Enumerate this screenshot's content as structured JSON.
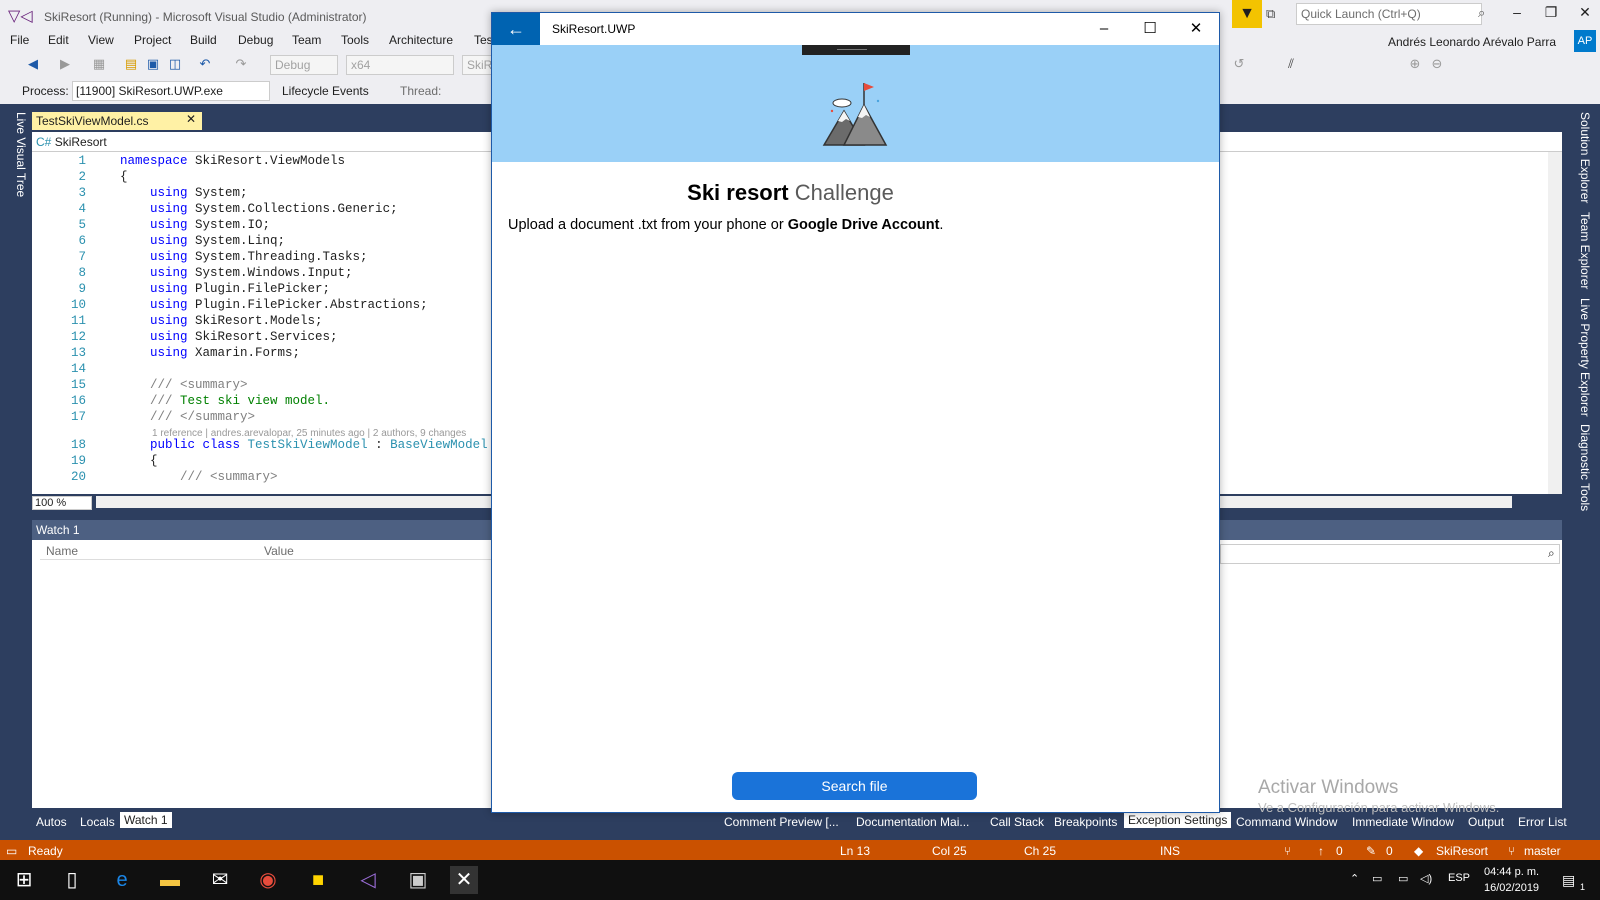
{
  "vs": {
    "title": "SkiResort (Running) - Microsoft Visual Studio  (Administrator)",
    "quick_launch_placeholder": "Quick Launch (Ctrl+Q)",
    "menu": [
      "File",
      "Edit",
      "View",
      "Project",
      "Build",
      "Debug",
      "Team",
      "Tools",
      "Architecture",
      "Tes"
    ],
    "user": "Andrés Leonardo Arévalo Parra",
    "user_initials": "AP",
    "config": "Debug",
    "platform": "x64",
    "startup_project": "SkiRe",
    "process_label": "Process:",
    "process_value": "[11900] SkiResort.UWP.exe",
    "lifecycle_events": "Lifecycle Events",
    "thread_label": "Thread:",
    "live_visual_tree": "Live Visual Tree",
    "doc_tab": "TestSkiViewModel.cs",
    "nav_project": "SkiResort",
    "zoom": "100 %",
    "right_tabs": [
      "Solution Explorer",
      "Team Explorer",
      "Live Property Explorer",
      "Diagnostic Tools"
    ],
    "code": {
      "lines": [
        {
          "n": "1",
          "parts": [
            {
              "c": "kw",
              "t": "namespace"
            },
            {
              "c": "",
              "t": " SkiResort.ViewModels"
            }
          ]
        },
        {
          "n": "2",
          "parts": [
            {
              "c": "",
              "t": "{"
            }
          ]
        },
        {
          "n": "3",
          "parts": [
            {
              "c": "",
              "t": "    "
            },
            {
              "c": "kw",
              "t": "using"
            },
            {
              "c": "",
              "t": " System;"
            }
          ]
        },
        {
          "n": "4",
          "parts": [
            {
              "c": "",
              "t": "    "
            },
            {
              "c": "kw",
              "t": "using"
            },
            {
              "c": "",
              "t": " System.Collections.Generic;"
            }
          ]
        },
        {
          "n": "5",
          "parts": [
            {
              "c": "",
              "t": "    "
            },
            {
              "c": "kw",
              "t": "using"
            },
            {
              "c": "",
              "t": " System.IO;"
            }
          ]
        },
        {
          "n": "6",
          "parts": [
            {
              "c": "",
              "t": "    "
            },
            {
              "c": "kw",
              "t": "using"
            },
            {
              "c": "",
              "t": " System.Linq;"
            }
          ]
        },
        {
          "n": "7",
          "parts": [
            {
              "c": "",
              "t": "    "
            },
            {
              "c": "kw",
              "t": "using"
            },
            {
              "c": "",
              "t": " System.Threading.Tasks;"
            }
          ]
        },
        {
          "n": "8",
          "parts": [
            {
              "c": "",
              "t": "    "
            },
            {
              "c": "kw",
              "t": "using"
            },
            {
              "c": "",
              "t": " System.Windows.Input;"
            }
          ]
        },
        {
          "n": "9",
          "parts": [
            {
              "c": "",
              "t": "    "
            },
            {
              "c": "kw",
              "t": "using"
            },
            {
              "c": "",
              "t": " Plugin.FilePicker;"
            }
          ]
        },
        {
          "n": "10",
          "parts": [
            {
              "c": "",
              "t": "    "
            },
            {
              "c": "kw",
              "t": "using"
            },
            {
              "c": "",
              "t": " Plugin.FilePicker.Abstractions;"
            }
          ]
        },
        {
          "n": "11",
          "parts": [
            {
              "c": "",
              "t": "    "
            },
            {
              "c": "kw",
              "t": "using"
            },
            {
              "c": "",
              "t": " SkiResort.Models;"
            }
          ]
        },
        {
          "n": "12",
          "parts": [
            {
              "c": "",
              "t": "    "
            },
            {
              "c": "kw",
              "t": "using"
            },
            {
              "c": "",
              "t": " SkiResort.Services;"
            }
          ]
        },
        {
          "n": "13",
          "parts": [
            {
              "c": "",
              "t": "    "
            },
            {
              "c": "kw",
              "t": "using"
            },
            {
              "c": "",
              "t": " Xamarin.Forms;"
            }
          ]
        },
        {
          "n": "14",
          "parts": []
        },
        {
          "n": "15",
          "parts": [
            {
              "c": "",
              "t": "    "
            },
            {
              "c": "cmg",
              "t": "/// <summary>"
            }
          ]
        },
        {
          "n": "16",
          "parts": [
            {
              "c": "",
              "t": "    "
            },
            {
              "c": "cmg",
              "t": "///"
            },
            {
              "c": "cm",
              "t": " Test ski view model."
            }
          ]
        },
        {
          "n": "17",
          "parts": [
            {
              "c": "",
              "t": "    "
            },
            {
              "c": "cmg",
              "t": "/// </summary>"
            }
          ]
        },
        {
          "n": "",
          "lens": "1 reference | andres.arevalopar, 25 minutes ago | 2 authors, 9 changes"
        },
        {
          "n": "18",
          "parts": [
            {
              "c": "",
              "t": "    "
            },
            {
              "c": "kw",
              "t": "public class"
            },
            {
              "c": "",
              "t": " "
            },
            {
              "c": "tp",
              "t": "TestSkiViewModel"
            },
            {
              "c": "",
              "t": " : "
            },
            {
              "c": "tp",
              "t": "BaseViewModel"
            }
          ]
        },
        {
          "n": "19",
          "parts": [
            {
              "c": "",
              "t": "    {"
            }
          ]
        },
        {
          "n": "20",
          "parts": [
            {
              "c": "",
              "t": "        "
            },
            {
              "c": "cmg",
              "t": "/// <summary>"
            }
          ]
        }
      ]
    },
    "watch": {
      "title": "Watch 1",
      "col_name": "Name",
      "col_value": "Value"
    },
    "bottom_tabs_left": [
      "Autos",
      "Locals",
      "Watch 1"
    ],
    "bottom_tabs_right": [
      "Comment Preview [...",
      "Documentation Mai...",
      "Call Stack",
      "Breakpoints",
      "Exception Settings",
      "Command Window",
      "Immediate Window",
      "Output",
      "Error List"
    ],
    "status": {
      "ready": "Ready",
      "ln": "Ln 13",
      "col": "Col 25",
      "ch": "Ch 25",
      "ins": "INS",
      "pending_up": "0",
      "pending_edits": "0",
      "repo": "SkiResort",
      "branch": "master"
    },
    "activate_title": "Activar Windows",
    "activate_sub": "Ve a Configuración para activar Windows."
  },
  "taskbar": {
    "lang": "ESP",
    "time": "04:44 p. m.",
    "date": "16/02/2019",
    "notifications": "1"
  },
  "uwp": {
    "window_title": "SkiResort.UWP",
    "title_bold": "Ski resort",
    "title_light": "Challenge",
    "desc_prefix": "Upload a document .txt from your phone or ",
    "desc_bold": "Google Drive Account",
    "desc_suffix": ".",
    "button_label": "Search file",
    "header_color": "#9ad0f7",
    "accent": "#1a73d9"
  },
  "colors": {
    "status_bar": "#ca5100",
    "vs_dark": "#2d3e5f"
  }
}
